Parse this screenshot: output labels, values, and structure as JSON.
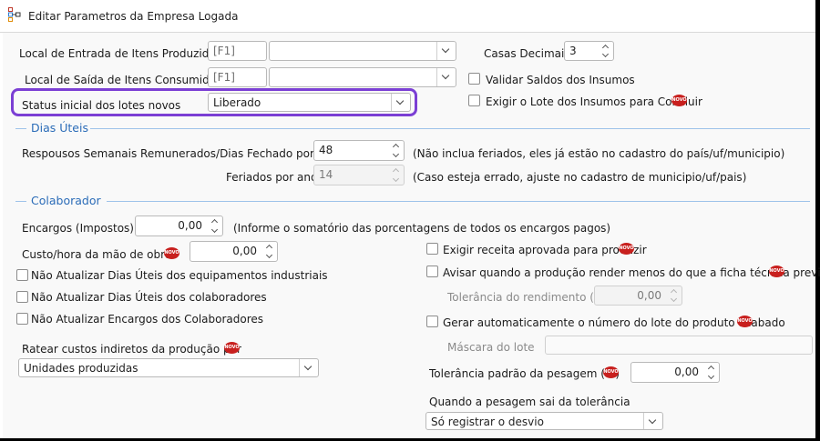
{
  "window": {
    "title": "Editar Parametros da Empresa Logada"
  },
  "top": {
    "local_entrada_label": "Local de Entrada de Itens Produzidos",
    "local_entrada_code": "[F1]",
    "local_entrada_value": "",
    "local_saida_label": "Local de Saída de Itens Consumidos",
    "local_saida_code": "[F1]",
    "local_saida_value": "",
    "status_label": "Status inicial dos lotes novos",
    "status_value": "Liberado",
    "casas_label": "Casas Decimais",
    "casas_value": "3",
    "validar_label": "Validar Saldos dos Insumos",
    "exigir_lote_label": "Exigir o Lote dos Insumos para Concluir"
  },
  "dias_uteis": {
    "section_title": "Dias Úteis",
    "repousos_label": "Respousos Semanais Remunerados/Dias Fechado por ano",
    "repousos_value": "48",
    "repousos_hint": "(Não inclua feriados, eles já estão no cadastro do país/uf/municipio)",
    "feriados_label": "Feriados por ano",
    "feriados_value": "14",
    "feriados_hint": "(Caso esteja errado, ajuste no cadastro de municipio/uf/pais)"
  },
  "colaborador": {
    "section_title": "Colaborador",
    "encargos_label": "Encargos (Impostos)",
    "encargos_value": "0,00",
    "encargos_hint": "(Informe o somatório das porcentagens de todos os encargos pagos)",
    "custo_label": "Custo/hora da mão de obra:",
    "custo_value": "0,00",
    "nao_atualizar_equip": "Não Atualizar Dias Úteis dos equipamentos industriais",
    "nao_atualizar_colab": "Não Atualizar Dias Úteis dos colaboradores",
    "nao_atualizar_encargos": "Não Atualizar Encargos dos Colaboradores",
    "ratear_label": "Ratear custos indiretos da produção por",
    "ratear_value": "Unidades produzidas"
  },
  "right_panel": {
    "exigir_receita": "Exigir receita aprovada para produzir",
    "avisar_producao": "Avisar quando a produção render menos do que a ficha técnica previa",
    "tolerancia_rend_label": "Tolerância do rendimento (%)",
    "tolerancia_rend_value": "0,00",
    "gerar_lote": "Gerar automaticamente o número do lote do produto acabado",
    "mascara_label": "Máscara do lote",
    "mascara_value": "",
    "tolerancia_pesagem_label": "Tolerância padrão da pesagem (%)",
    "tolerancia_pesagem_value": "0,00",
    "quando_pesagem_label": "Quando a pesagem sai da tolerância",
    "quando_pesagem_value": "Só registrar o desvio"
  },
  "badges": {
    "novo_text": "NOVO",
    "novo_color": "#c8201e"
  },
  "colors": {
    "highlight": "#7b3fd4",
    "section": "#2b6cb8"
  }
}
